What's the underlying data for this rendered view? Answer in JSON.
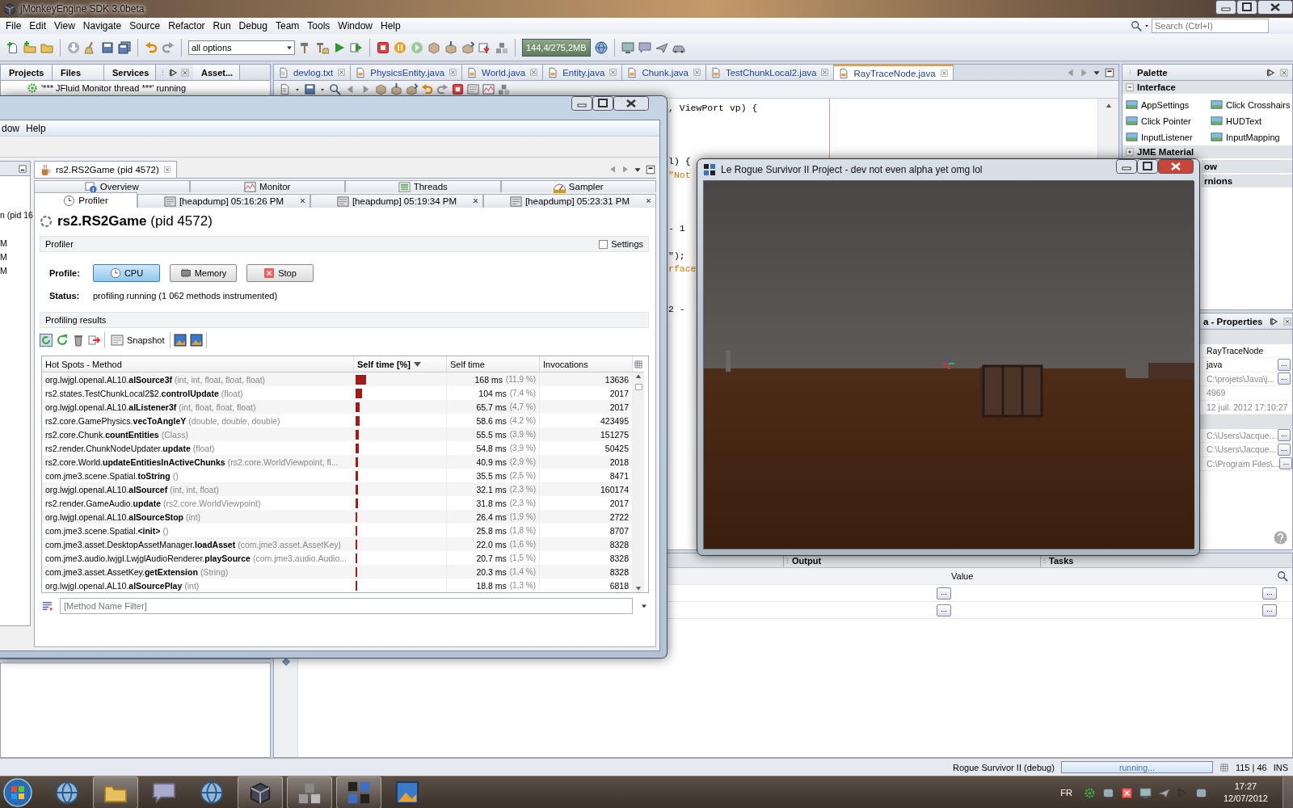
{
  "ide": {
    "title": "jMonkeyEngine SDK 3.0beta",
    "menu": [
      "File",
      "Edit",
      "View",
      "Navigate",
      "Source",
      "Refactor",
      "Run",
      "Debug",
      "Team",
      "Tools",
      "Window",
      "Help"
    ],
    "search": {
      "placeholder": "Search (Ctrl+I)"
    },
    "run_config": "all options",
    "memory": "144,4/275,2MB",
    "left_tabs": [
      "Projects",
      "Files",
      "Services",
      "Asset..."
    ],
    "threads": [
      "'*** JFluid Monitor thread ***' running"
    ],
    "editor_tabs": [
      {
        "label": "devlog.txt",
        "kind": "text",
        "selected": false
      },
      {
        "label": "PhysicsEntity.java",
        "kind": "java",
        "selected": false
      },
      {
        "label": "World.java",
        "kind": "java",
        "selected": false
      },
      {
        "label": "Entity.java",
        "kind": "java",
        "selected": false
      },
      {
        "label": "Chunk.java",
        "kind": "java",
        "selected": false
      },
      {
        "label": "TestChunkLocal2.java",
        "kind": "java",
        "selected": false
      },
      {
        "label": "RayTraceNode.java",
        "kind": "java",
        "selected": true
      }
    ],
    "code_lines": [
      {
        "text": ", ViewPort vp) {",
        "kind": "plain"
      },
      {
        "text": "l) {",
        "kind": "plain"
      },
      {
        "text": "\"Not",
        "kind": "string"
      },
      {
        "text": "- 1",
        "kind": "plain"
      },
      {
        "text": "\");",
        "kind": "plain"
      },
      {
        "text": "rface",
        "kind": "string"
      },
      {
        "text": "2 -",
        "kind": "plain"
      }
    ],
    "palette": {
      "title": "Palette",
      "categories": [
        {
          "label": "Interface",
          "expanded": true,
          "items": [
            "AppSettings",
            "Click Crosshairs",
            "Click Pointer",
            "HUDText",
            "InputListener",
            "InputMapping"
          ]
        },
        {
          "label": "JME Material",
          "expanded": false
        },
        {
          "label": "ow"
        },
        {
          "label": "rnions"
        }
      ]
    },
    "properties": {
      "title": "a - Properties",
      "rows": [
        {
          "kind": "section"
        },
        {
          "kind": "value",
          "value": "RayTraceNode",
          "disabled": false
        },
        {
          "kind": "value",
          "value": "java",
          "disabled": false,
          "button": "..."
        },
        {
          "kind": "value",
          "value": "C:\\projets\\Java\\j...",
          "disabled": true,
          "button": "..."
        },
        {
          "kind": "value",
          "value": "4969",
          "disabled": true
        },
        {
          "kind": "value",
          "value": "12 juil. 2012 17:10:27",
          "disabled": true
        },
        {
          "kind": "section"
        },
        {
          "kind": "value",
          "value": "C:\\Users\\Jacque...",
          "disabled": true,
          "button": "..."
        },
        {
          "kind": "value",
          "value": "C:\\Users\\Jacque...",
          "disabled": true,
          "button": "..."
        },
        {
          "kind": "value",
          "value": "C:\\Program Files\\...",
          "disabled": true,
          "button": "..."
        }
      ]
    },
    "bottom": {
      "tabs": [
        "Output",
        "Tasks"
      ],
      "column": "Value",
      "rows": [
        [
          "...",
          "..."
        ],
        [
          "...",
          "..."
        ]
      ]
    },
    "status": {
      "task": "Rogue Survivor II (debug)",
      "progress": {
        "label": "running...",
        "level": 1
      },
      "position": "115 | 46",
      "mode": "INS"
    }
  },
  "profiler": {
    "menu": [
      "dow",
      "Help"
    ],
    "side": [
      "n (pid 16",
      "M",
      "M",
      "M"
    ],
    "doc_tab": "rs2.RS2Game (pid 4572)",
    "view_tabs": [
      {
        "label": "Overview",
        "kind": "overview",
        "selected": false
      },
      {
        "label": "Monitor",
        "kind": "monitor",
        "selected": false
      },
      {
        "label": "Threads",
        "kind": "threads",
        "selected": false
      },
      {
        "label": "Sampler",
        "kind": "sampler",
        "selected": false
      }
    ],
    "view_tabs_2": [
      {
        "label": "Profiler",
        "kind": "profiler",
        "selected": true
      },
      {
        "label": "[heapdump] 05:16:26 PM",
        "kind": "heapdump",
        "selected": false
      },
      {
        "label": "[heapdump] 05:19:34 PM",
        "kind": "heapdump",
        "selected": false
      },
      {
        "label": "[heapdump] 05:23:31 PM",
        "kind": "heapdump",
        "selected": false
      }
    ],
    "heading": "**rs2.RS2Game** (pid 4572)",
    "section": "Profiler",
    "settings": {
      "label": "Settings",
      "checked": false
    },
    "profile_label": "Profile:",
    "modes": [
      {
        "label": "CPU",
        "kind": "cpu",
        "selected": true
      },
      {
        "label": "Memory",
        "kind": "memory",
        "selected": false
      },
      {
        "label": "Stop",
        "kind": "stop",
        "selected": false
      }
    ],
    "status_label": "Status:",
    "status": "profiling running (1 062 methods instrumented)",
    "results": "Profiling results",
    "snapshot": "Snapshot",
    "table": {
      "columns": [
        {
          "label": "Hot Spots - Method",
          "sorted": false
        },
        {
          "label": "Self time [%]",
          "sorted": true
        },
        {
          "label": "Self time",
          "sorted": false
        },
        {
          "label": "Invocations",
          "sorted": false
        }
      ],
      "rows": [
        {
          "method": "org.lwjgl.openal.AL10.**alSource3f**",
          "args": "(int, int, float, float, float)",
          "level": 0.119,
          "time": "168 ms",
          "percent": "(11,9 %)",
          "invocations": "13636"
        },
        {
          "method": "rs2.states.TestChunkLocal2$2.**controlUpdate**",
          "args": "(float)",
          "level": 0.074,
          "time": "104 ms",
          "percent": "(7,4 %)",
          "invocations": "2017"
        },
        {
          "method": "org.lwjgl.openal.AL10.**alListener3f**",
          "args": "(int, float, float, float)",
          "level": 0.047,
          "time": "65.7 ms",
          "percent": "(4,7 %)",
          "invocations": "2017"
        },
        {
          "method": "rs2.core.GamePhysics.**vecToAngleY**",
          "args": "(double, double, double)",
          "level": 0.042,
          "time": "58.6 ms",
          "percent": "(4,2 %)",
          "invocations": "423495"
        },
        {
          "method": "rs2.core.Chunk.**countEntities**",
          "args": "(Class)",
          "level": 0.039,
          "time": "55.5 ms",
          "percent": "(3,9 %)",
          "invocations": "151275"
        },
        {
          "method": "rs2.render.ChunkNodeUpdater.**update**",
          "args": "(float)",
          "level": 0.039,
          "time": "54.8 ms",
          "percent": "(3,9 %)",
          "invocations": "50425"
        },
        {
          "method": "rs2.core.World.**updateEntitiesInActiveChunks**",
          "args": "(rs2.core.WorldViewpoint, fl...",
          "level": 0.029,
          "time": "40.9 ms",
          "percent": "(2,9 %)",
          "invocations": "2018"
        },
        {
          "method": "com.jme3.scene.Spatial.**toString**",
          "args": "()",
          "level": 0.025,
          "time": "35.5 ms",
          "percent": "(2,5 %)",
          "invocations": "8471"
        },
        {
          "method": "org.lwjgl.openal.AL10.**alSourcef**",
          "args": "(int, int, float)",
          "level": 0.023,
          "time": "32.1 ms",
          "percent": "(2,3 %)",
          "invocations": "160174"
        },
        {
          "method": "rs2.render.GameAudio.**update**",
          "args": "(rs2.core.WorldViewpoint)",
          "level": 0.023,
          "time": "31.8 ms",
          "percent": "(2,3 %)",
          "invocations": "2017"
        },
        {
          "method": "org.lwjgl.openal.AL10.**alSourceStop**",
          "args": "(int)",
          "level": 0.019,
          "time": "26.4 ms",
          "percent": "(1,9 %)",
          "invocations": "2722"
        },
        {
          "method": "com.jme3.scene.Spatial.**<init>**",
          "args": "()",
          "level": 0.018,
          "time": "25.8 ms",
          "percent": "(1,8 %)",
          "invocations": "8707"
        },
        {
          "method": "com.jme3.asset.DesktopAssetManager.**loadAsset**",
          "args": "(com.jme3.asset.AssetKey)",
          "level": 0.016,
          "time": "22.0 ms",
          "percent": "(1,6 %)",
          "invocations": "8328"
        },
        {
          "method": "com.jme3.audio.lwjgl.LwjglAudioRenderer.**playSource**",
          "args": "(com.jme3.audio.Audio...",
          "level": 0.015,
          "time": "20.7 ms",
          "percent": "(1,5 %)",
          "invocations": "8328"
        },
        {
          "method": "com.jme3.asset.AssetKey.**getExtension**",
          "args": "(String)",
          "level": 0.014,
          "time": "20.3 ms",
          "percent": "(1,4 %)",
          "invocations": "8328"
        },
        {
          "method": "org.lwjgl.openal.AL10.**alSourcePlay**",
          "args": "(int)",
          "level": 0.013,
          "time": "18.8 ms",
          "percent": "(1,3 %)",
          "invocations": "6818"
        }
      ]
    },
    "filter": {
      "placeholder": "[Method Name Filter]"
    }
  },
  "game": {
    "title": "Le Rogue Survivor II Project - dev not even alpha yet omg lol"
  },
  "taskbar": {
    "language": "FR",
    "time": "17:27",
    "date": "12/07/2012"
  }
}
